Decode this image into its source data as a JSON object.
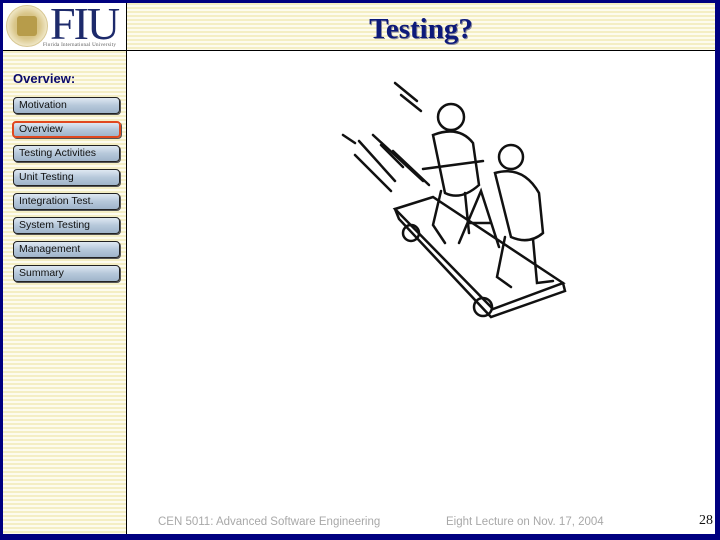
{
  "header": {
    "logo_text": "FIU",
    "logo_subtitle": "Florida International University",
    "title": "Testing?"
  },
  "sidebar": {
    "section_label": "Overview:",
    "items": [
      {
        "label": "Motivation",
        "active": false
      },
      {
        "label": "Overview",
        "active": true
      },
      {
        "label": "Testing Activities",
        "active": false
      },
      {
        "label": "Unit Testing",
        "active": false
      },
      {
        "label": "Integration Test.",
        "active": false
      },
      {
        "label": "System Testing",
        "active": false
      },
      {
        "label": "Management",
        "active": false
      },
      {
        "label": "Summary",
        "active": false
      }
    ]
  },
  "main": {
    "illustration": "cartoon of two men on a speeding handcar"
  },
  "footer": {
    "course": "CEN 5011: Advanced Software Engineering",
    "lecture": "Eight Lecture on Nov. 17, 2004",
    "page_number": "28"
  },
  "colors": {
    "frame": "#000080",
    "title": "#0d1a7a",
    "active_border": "#e0481e"
  }
}
